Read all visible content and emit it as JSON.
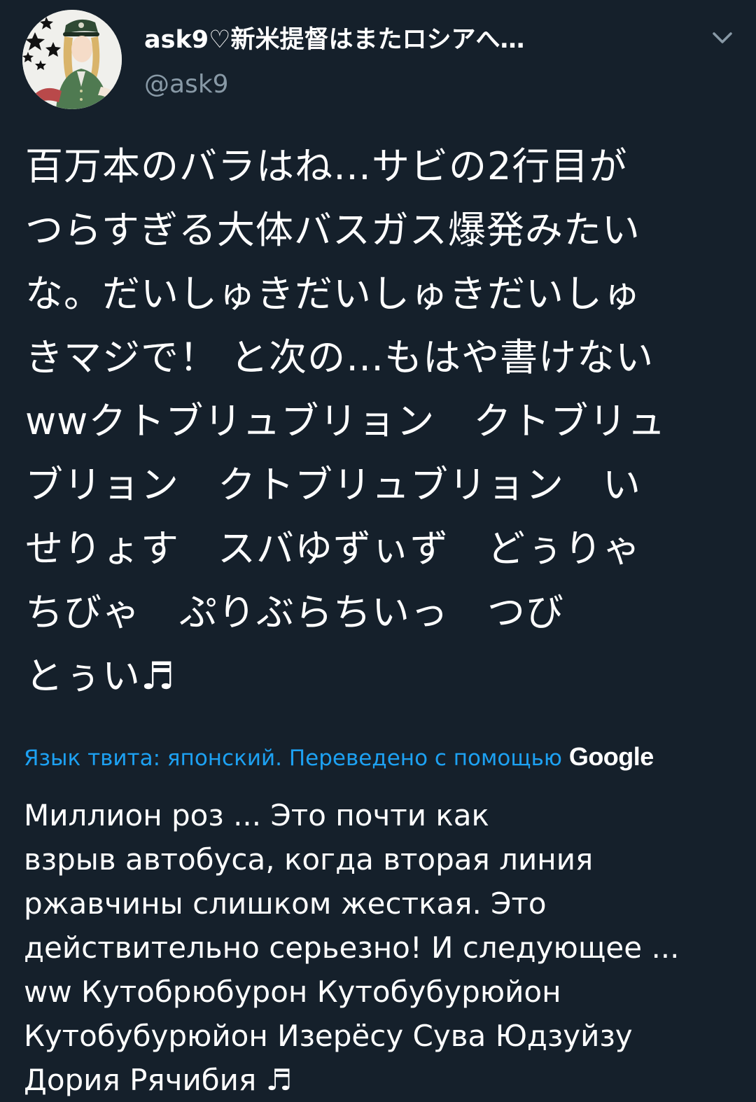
{
  "tweet": {
    "author": {
      "display_name": "ask9♡新米提督はまたロシアへ…",
      "handle": "@ask9",
      "avatar": "avatar-illustration"
    },
    "menu_icon": "chevron-down-icon",
    "text_lines": [
      "百万本のバラはね…サビの2行目が",
      "つらすぎる大体バスガス爆発みたい",
      "な。だいしゅきだいしゅきだいしゅ",
      "きマジで！ と次の…もはや書けない",
      "wwクトブリュブリョン　クトブリュ",
      "ブリョン　クトブリュブリョン　い",
      "せりょす　スバゆずぃず　どぅりゃ",
      "ちびゃ　ぷりぶらちいっ　つび",
      "とぅい♬"
    ],
    "translation_note": "Язык твита: японский. Переведено с помощью ",
    "translation_provider": "Google",
    "translation_lines": [
      "Миллион роз ... Это почти как",
      "взрыв автобуса, когда вторая линия",
      "ржавчины слишком жесткая. Это",
      "действительно серьезно! И следующее ...",
      "ww Кутобрюбурон Кутобубурюйон",
      "Кутобубурюйон Изерёсу Сува Юдзуйзу",
      "Дория Рячибия ♬"
    ]
  },
  "colors": {
    "background": "#15202b",
    "text": "#ffffff",
    "secondary_text": "#8899a6",
    "link": "#1da1f2"
  }
}
